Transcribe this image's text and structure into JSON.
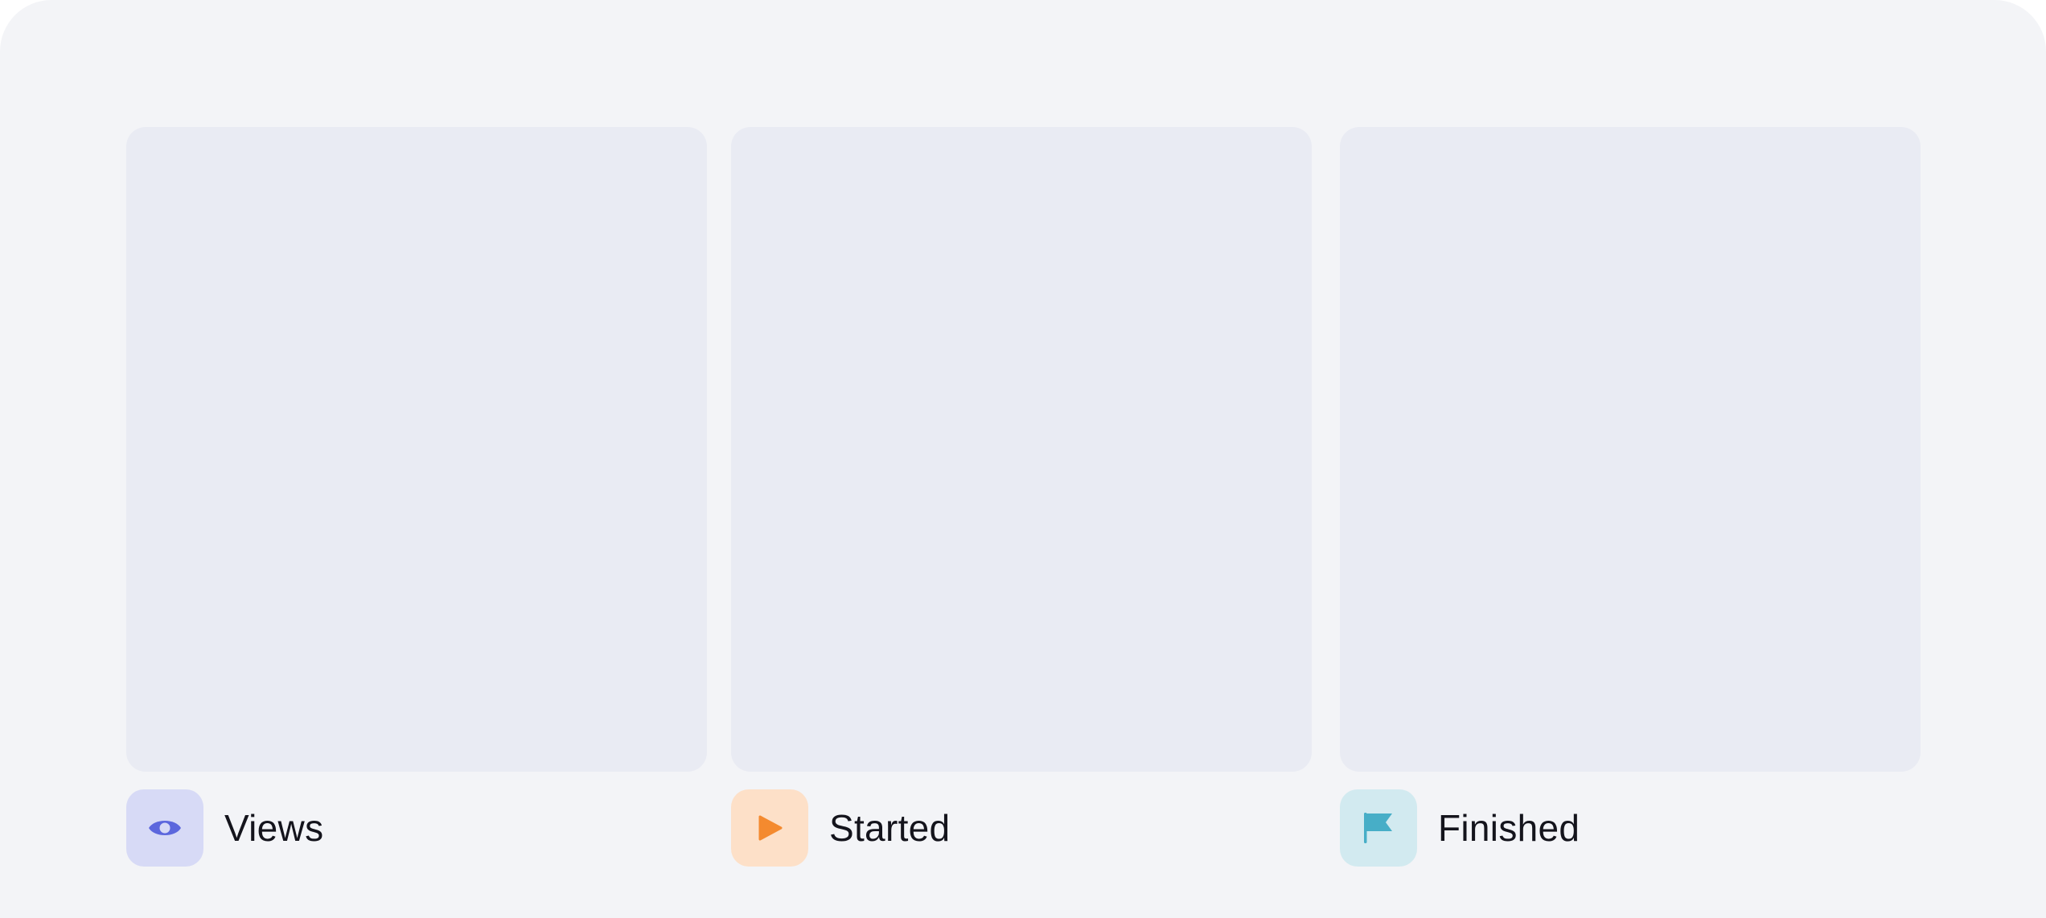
{
  "metrics": [
    {
      "label": "Views",
      "icon": "eye-icon",
      "color": "#5c67dd",
      "bg": "#d7daf6"
    },
    {
      "label": "Started",
      "icon": "play-icon",
      "color": "#f48a2f",
      "bg": "#fde0c8"
    },
    {
      "label": "Finished",
      "icon": "flag-icon",
      "color": "#47aec7",
      "bg": "#d2eaf0"
    }
  ]
}
